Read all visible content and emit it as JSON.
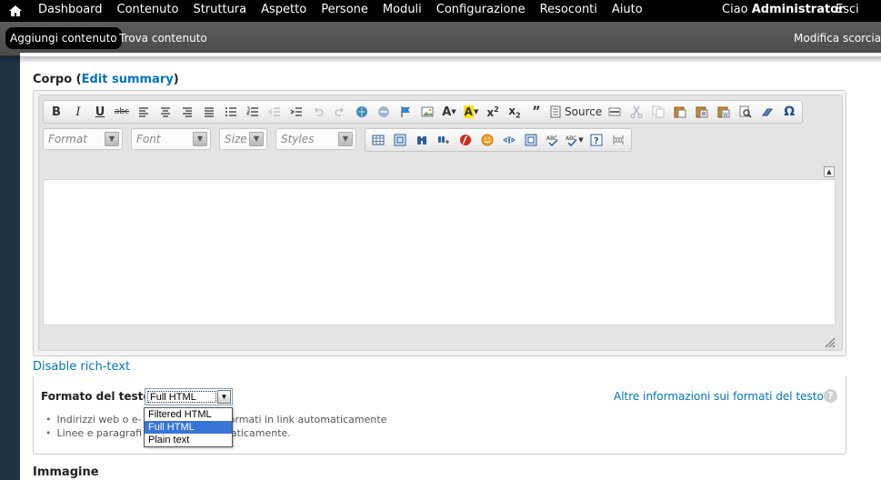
{
  "toolbar": {
    "menu": [
      "Dashboard",
      "Contenuto",
      "Struttura",
      "Aspetto",
      "Persone",
      "Moduli",
      "Configurazione",
      "Resoconti",
      "Aiuto"
    ],
    "greeting": "Ciao",
    "username": "Administrator",
    "logout": "Esci"
  },
  "shortcuts": {
    "add_content": "Aggiungi contenuto",
    "find_content": "Trova contenuto",
    "edit_shortcuts": "Modifica scorciato"
  },
  "field": {
    "label": "Corpo",
    "edit_summary": "Edit summary"
  },
  "editor": {
    "source_label": "Source",
    "combos": [
      "Format",
      "Font",
      "Size",
      "Styles"
    ],
    "icons_row1": [
      "bold-icon",
      "italic-icon",
      "underline-icon",
      "strikethrough-icon",
      "align-left-icon",
      "align-center-icon",
      "align-right-icon",
      "justify-icon",
      "bulleted-list-icon",
      "numbered-list-icon",
      "outdent-icon",
      "indent-icon",
      "undo-icon",
      "redo-icon",
      "link-icon",
      "unlink-icon",
      "anchor-icon",
      "image-icon",
      "text-color-icon",
      "background-color-icon",
      "superscript-icon",
      "subscript-icon",
      "blockquote-icon",
      "source-icon",
      "horizontal-rule-icon",
      "cut-icon",
      "copy-icon",
      "paste-icon",
      "paste-text-icon",
      "paste-word-icon",
      "find-icon",
      "remove-format-icon",
      "special-char-icon"
    ],
    "icons_row2": [
      "table-icon",
      "maximize-icon",
      "find-icon",
      "replace-icon",
      "flash-icon",
      "smiley-icon",
      "show-blocks-icon",
      "iframe-icon",
      "spellcheck-icon",
      "scayt-icon",
      "about-icon",
      "page-break-icon"
    ]
  },
  "disable_rich_text": "Disable rich-text",
  "text_format": {
    "label": "Formato del testo",
    "selected": "Full HTML",
    "options": [
      "Filtered HTML",
      "Full HTML",
      "Plain text"
    ],
    "more_info": "Altre informazioni sui formati del testo",
    "tips": [
      {
        "before": "Indirizzi web o e-",
        "after": "ormati in link automaticamente"
      },
      {
        "before": "Linee e paragrafi",
        "after": "maticamente."
      }
    ]
  },
  "next_field": "Immagine"
}
